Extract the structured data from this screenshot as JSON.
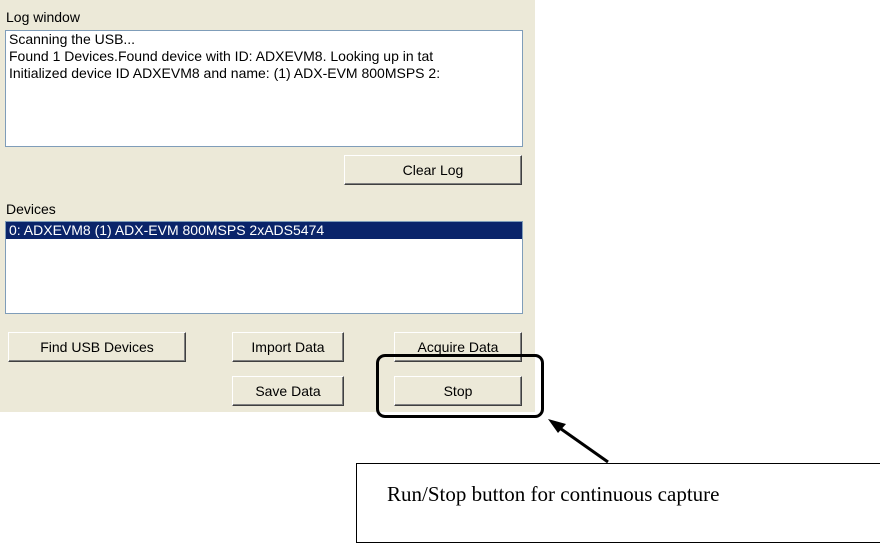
{
  "log": {
    "title": "Log window",
    "lines": [
      "Scanning the USB...",
      "Found 1 Devices.Found device with ID: ADXEVM8. Looking up in tat",
      "Initialized device ID ADXEVM8 and name: (1) ADX-EVM 800MSPS 2:"
    ],
    "clear_label": "Clear Log"
  },
  "devices": {
    "title": "Devices",
    "items": [
      "0: ADXEVM8 (1) ADX-EVM 800MSPS 2xADS5474"
    ]
  },
  "buttons": {
    "find_usb": "Find USB Devices",
    "import_data": "Import Data",
    "acquire_data": "Acquire Data",
    "save_data": "Save Data",
    "stop": "Stop"
  },
  "annotation": {
    "text": "Run/Stop button for continuous capture"
  }
}
